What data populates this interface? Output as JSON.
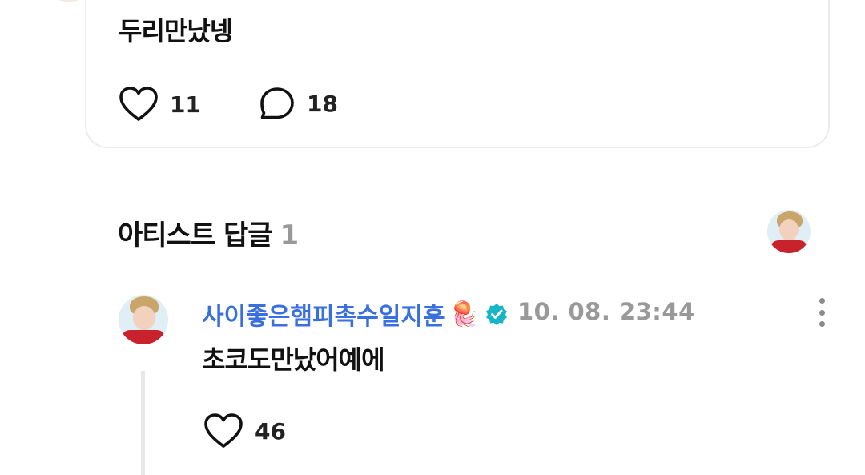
{
  "post": {
    "text": "두리만났넹",
    "likes": "11",
    "comments": "18"
  },
  "section": {
    "title": "아티스트 답글",
    "count": "1"
  },
  "reply": {
    "author": "사이좋은햄피촉수일지훈",
    "emoji": "🪼",
    "timestamp": "10. 08. 23:44",
    "text": "초코도만났어예에",
    "likes": "46"
  },
  "colors": {
    "author_blue": "#3a6fe0",
    "verified_teal": "#18b5c8",
    "muted_gray": "#999999"
  },
  "icons": [
    "heart-icon",
    "comment-bubble-icon",
    "verified-badge-icon",
    "more-options-icon"
  ]
}
